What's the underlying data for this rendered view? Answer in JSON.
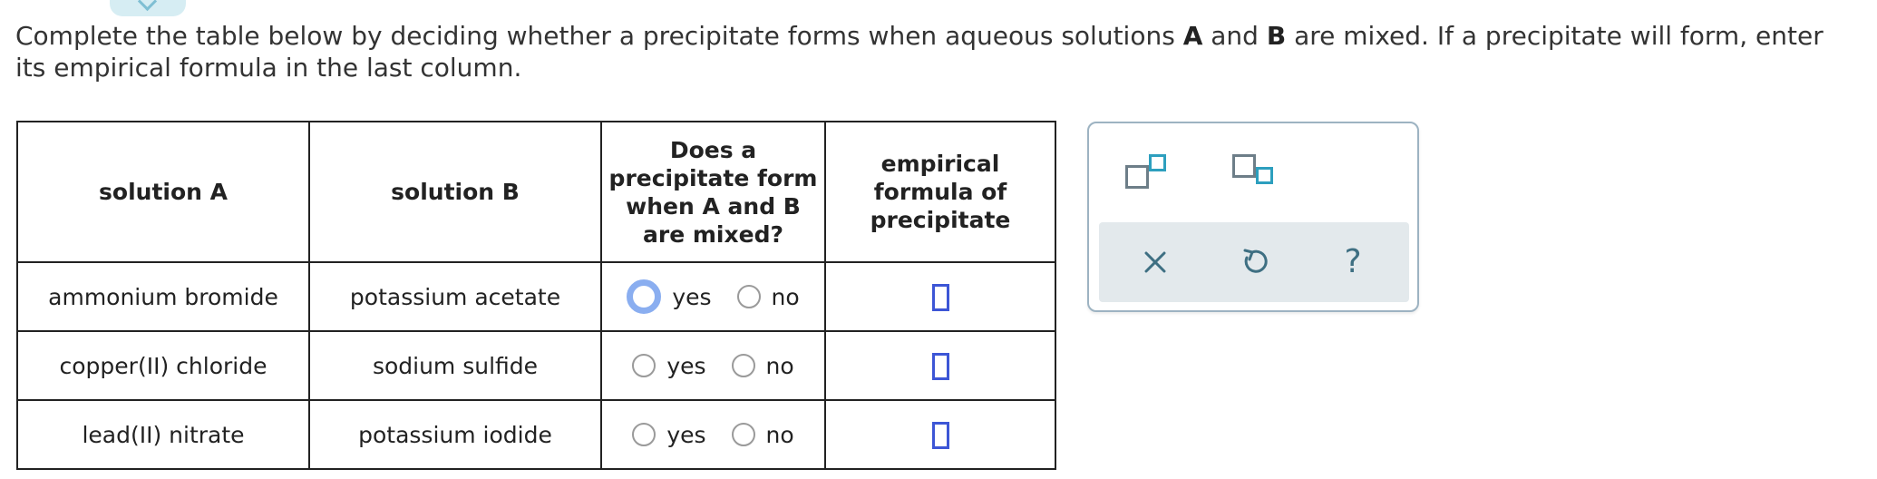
{
  "prompt": {
    "part1": "Complete the table below by deciding whether a precipitate forms when aqueous solutions ",
    "a": "A",
    "part2": " and ",
    "b": "B",
    "part3": " are mixed. If a precipitate will form, enter its empirical formula in the last column."
  },
  "table": {
    "headers": {
      "col1": "solution A",
      "col2": "solution B",
      "col3_lines": [
        "Does a",
        "precipitate form",
        "when A and B",
        "are mixed?"
      ],
      "col4_lines": [
        "empirical",
        "formula of",
        "precipitate"
      ]
    },
    "yes_label": "yes",
    "no_label": "no",
    "rows": [
      {
        "solution_a": "ammonium bromide",
        "solution_b": "potassium acetate"
      },
      {
        "solution_a": "copper(II) chloride",
        "solution_b": "sodium sulfide"
      },
      {
        "solution_a": "lead(II) nitrate",
        "solution_b": "potassium iodide"
      }
    ]
  },
  "palette": {
    "icons": [
      "superscript-icon",
      "subscript-icon",
      "clear-icon",
      "undo-icon",
      "help-icon"
    ],
    "help_glyph": "?",
    "accent_color": "#2d9fbe",
    "icon_color": "#6d7e88",
    "bar_color": "#e3e9ec"
  },
  "colors": {
    "focus_ring": "#8aaef0",
    "answer_box": "#3d56d6",
    "tab": "#d6edf3"
  }
}
